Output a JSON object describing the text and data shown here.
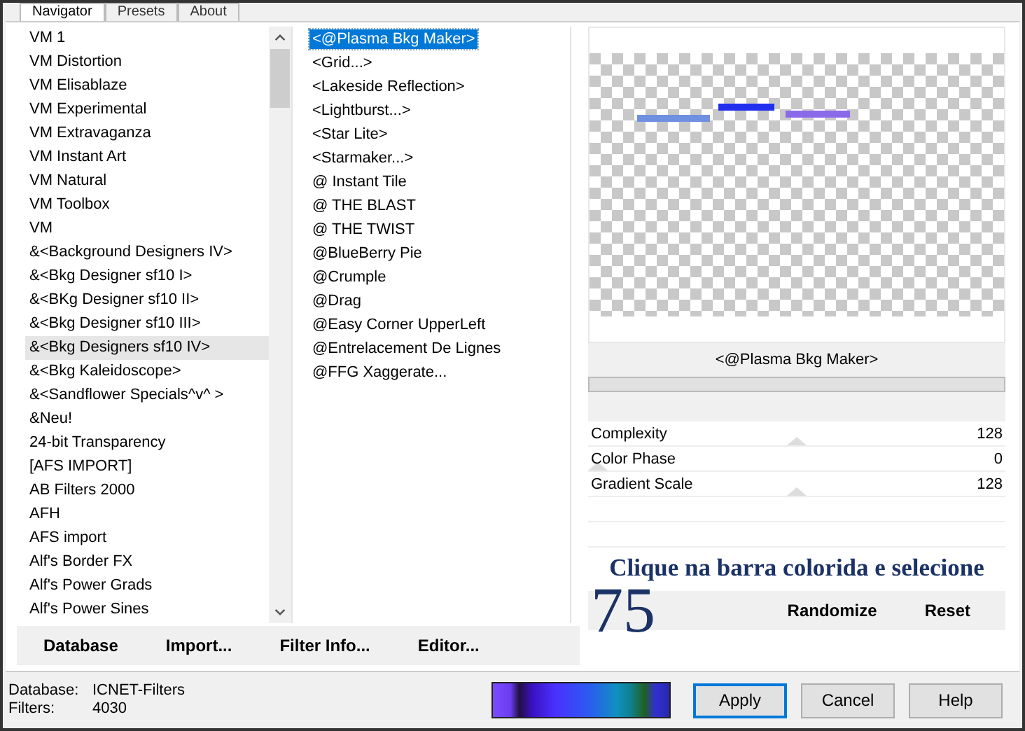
{
  "tabs": [
    {
      "label": "Navigator",
      "selected": true
    },
    {
      "label": "Presets",
      "selected": false
    },
    {
      "label": "About",
      "selected": false
    }
  ],
  "categories": [
    {
      "label": "VM 1",
      "selected": false
    },
    {
      "label": "VM Distortion",
      "selected": false
    },
    {
      "label": "VM Elisablaze",
      "selected": false
    },
    {
      "label": "VM Experimental",
      "selected": false
    },
    {
      "label": "VM Extravaganza",
      "selected": false
    },
    {
      "label": "VM Instant Art",
      "selected": false
    },
    {
      "label": "VM Natural",
      "selected": false
    },
    {
      "label": "VM Toolbox",
      "selected": false
    },
    {
      "label": "VM",
      "selected": false
    },
    {
      "label": "&<Background Designers IV>",
      "selected": false
    },
    {
      "label": "&<Bkg Designer sf10 I>",
      "selected": false
    },
    {
      "label": "&<BKg Designer sf10 II>",
      "selected": false
    },
    {
      "label": "&<Bkg Designer sf10 III>",
      "selected": false
    },
    {
      "label": "&<Bkg Designers sf10 IV>",
      "selected": true
    },
    {
      "label": "&<Bkg Kaleidoscope>",
      "selected": false
    },
    {
      "label": "&<Sandflower Specials^v^ >",
      "selected": false
    },
    {
      "label": "&Neu!",
      "selected": false
    },
    {
      "label": "24-bit Transparency",
      "selected": false
    },
    {
      "label": "[AFS IMPORT]",
      "selected": false
    },
    {
      "label": "AB Filters 2000",
      "selected": false
    },
    {
      "label": "AFH",
      "selected": false
    },
    {
      "label": "AFS import",
      "selected": false
    },
    {
      "label": "Alf's Border FX",
      "selected": false
    },
    {
      "label": "Alf's Power Grads",
      "selected": false
    },
    {
      "label": "Alf's Power Sines",
      "selected": false
    }
  ],
  "filters": [
    {
      "label": "<@Plasma Bkg Maker>",
      "selected": true
    },
    {
      "label": "<Grid...>",
      "selected": false
    },
    {
      "label": "<Lakeside Reflection>",
      "selected": false
    },
    {
      "label": "<Lightburst...>",
      "selected": false
    },
    {
      "label": "<Star Lite>",
      "selected": false
    },
    {
      "label": "<Starmaker...>",
      "selected": false
    },
    {
      "label": "@ Instant Tile",
      "selected": false
    },
    {
      "label": "@ THE BLAST",
      "selected": false
    },
    {
      "label": "@ THE TWIST",
      "selected": false
    },
    {
      "label": "@BlueBerry Pie",
      "selected": false
    },
    {
      "label": "@Crumple",
      "selected": false
    },
    {
      "label": "@Drag",
      "selected": false
    },
    {
      "label": "@Easy Corner UpperLeft",
      "selected": false
    },
    {
      "label": "@Entrelacement De Lignes",
      "selected": false
    },
    {
      "label": "@FFG Xaggerate...",
      "selected": false
    }
  ],
  "filter_title": "<@Plasma Bkg Maker>",
  "progress": {
    "level": 0
  },
  "parameters": [
    {
      "name": "Complexity",
      "value": "128",
      "level": 0.5
    },
    {
      "name": "Color Phase",
      "value": "0",
      "level": 0
    },
    {
      "name": "Gradient Scale",
      "value": "128",
      "level": 0.5
    }
  ],
  "overlay_caption": "Clique na barra colorida e selecione",
  "overlay_number": "75",
  "list_buttons": [
    "Database",
    "Import...",
    "Filter Info...",
    "Editor..."
  ],
  "filter_buttons": [
    "Randomize",
    "Reset"
  ],
  "status": [
    {
      "label": "Database:",
      "value": "ICNET-Filters"
    },
    {
      "label": "Filters:",
      "value": "4030"
    }
  ],
  "dialog_buttons": [
    {
      "label": "Apply",
      "default": true
    },
    {
      "label": "Cancel",
      "default": false
    },
    {
      "label": "Help",
      "default": false
    }
  ]
}
